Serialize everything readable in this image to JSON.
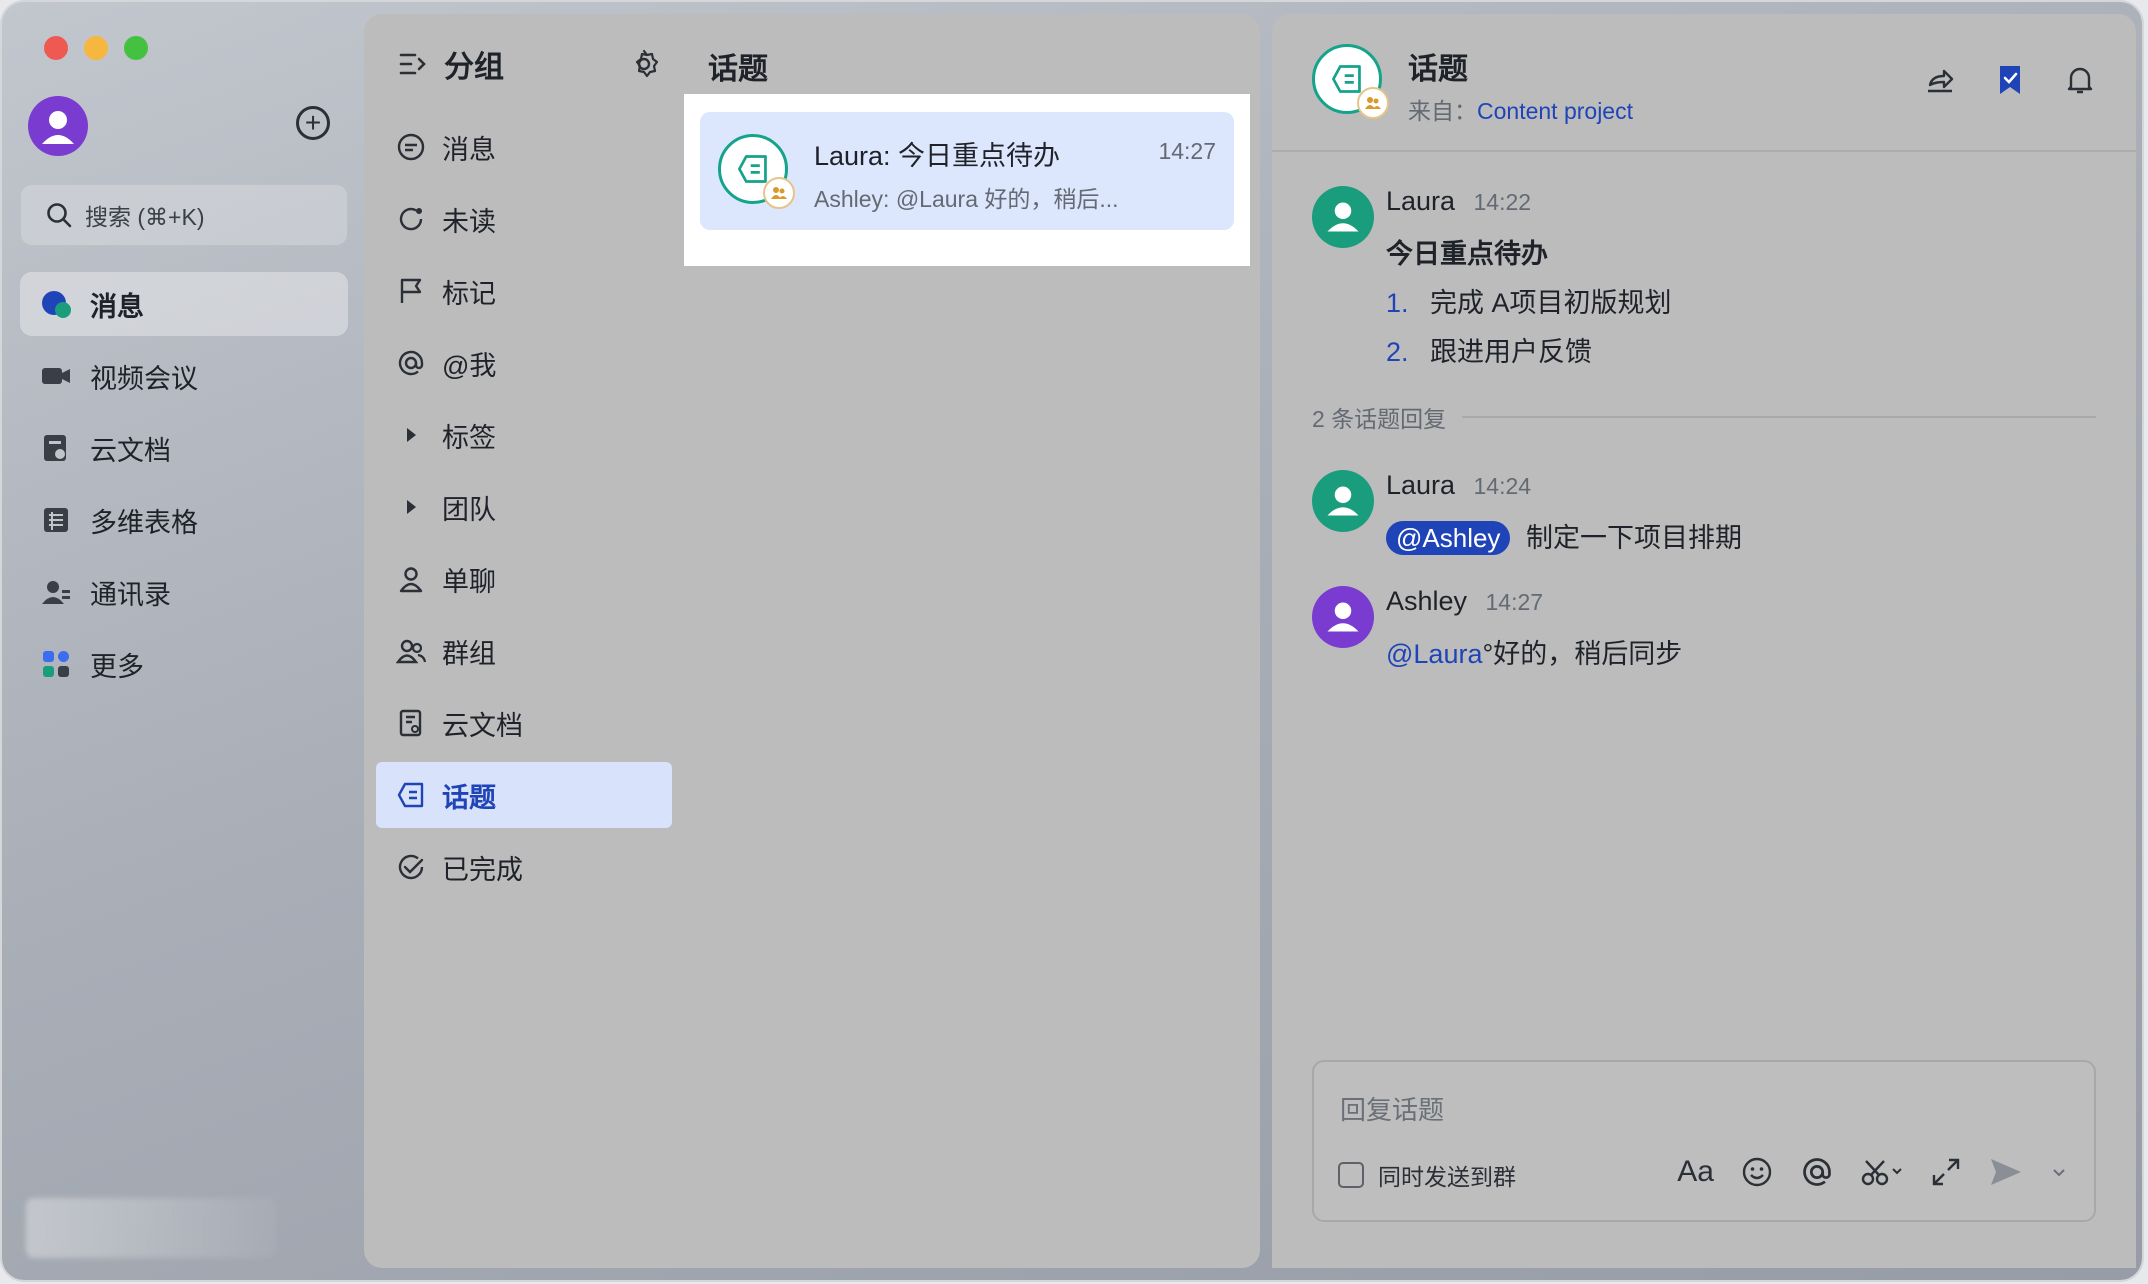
{
  "nav": {
    "search_placeholder": "搜索 (⌘+K)",
    "items": [
      {
        "label": "消息",
        "icon": "chat-bubble-icon",
        "active": true
      },
      {
        "label": "视频会议",
        "icon": "video-camera-icon"
      },
      {
        "label": "云文档",
        "icon": "cloud-doc-icon"
      },
      {
        "label": "多维表格",
        "icon": "table-grid-icon"
      },
      {
        "label": "通讯录",
        "icon": "contacts-icon"
      },
      {
        "label": "更多",
        "icon": "more-apps-icon"
      }
    ]
  },
  "groups": {
    "title": "分组",
    "items": [
      {
        "label": "消息",
        "icon": "message-icon"
      },
      {
        "label": "未读",
        "icon": "unread-icon"
      },
      {
        "label": "标记",
        "icon": "flag-icon"
      },
      {
        "label": "@我",
        "icon": "at-icon"
      },
      {
        "label": "标签",
        "icon": "caret-right-icon"
      },
      {
        "label": "团队",
        "icon": "caret-right-icon"
      },
      {
        "label": "单聊",
        "icon": "person-icon"
      },
      {
        "label": "群组",
        "icon": "people-icon"
      },
      {
        "label": "云文档",
        "icon": "doc-icon"
      },
      {
        "label": "话题",
        "icon": "topic-icon",
        "active": true
      },
      {
        "label": "已完成",
        "icon": "done-icon"
      }
    ]
  },
  "topics": {
    "title": "话题",
    "card": {
      "name": "Laura: 今日重点待办",
      "time": "14:27",
      "preview": "Ashley: @Laura 好的，稍后..."
    }
  },
  "detail": {
    "title": "话题",
    "from_label": "来自：",
    "from_link": "Content project",
    "root": {
      "name": "Laura",
      "time": "14:22",
      "heading": "今日重点待办",
      "items": [
        {
          "num": "1.",
          "text": "完成 A项目初版规划"
        },
        {
          "num": "2.",
          "text": "跟进用户反馈"
        }
      ]
    },
    "replies_label": "2 条话题回复",
    "reply1": {
      "name": "Laura",
      "time": "14:24",
      "mention": "@Ashley",
      "text": "制定一下项目排期"
    },
    "reply2": {
      "name": "Ashley",
      "time": "14:27",
      "mention": "@Laura",
      "text": "°好的，稍后同步"
    },
    "composer": {
      "placeholder": "回复话题",
      "also_send": "同时发送到群",
      "font_tool": "Aa"
    }
  },
  "colors": {
    "accent": "#1e44b8",
    "teal": "#14a38b",
    "purple": "#7a3bd1"
  }
}
